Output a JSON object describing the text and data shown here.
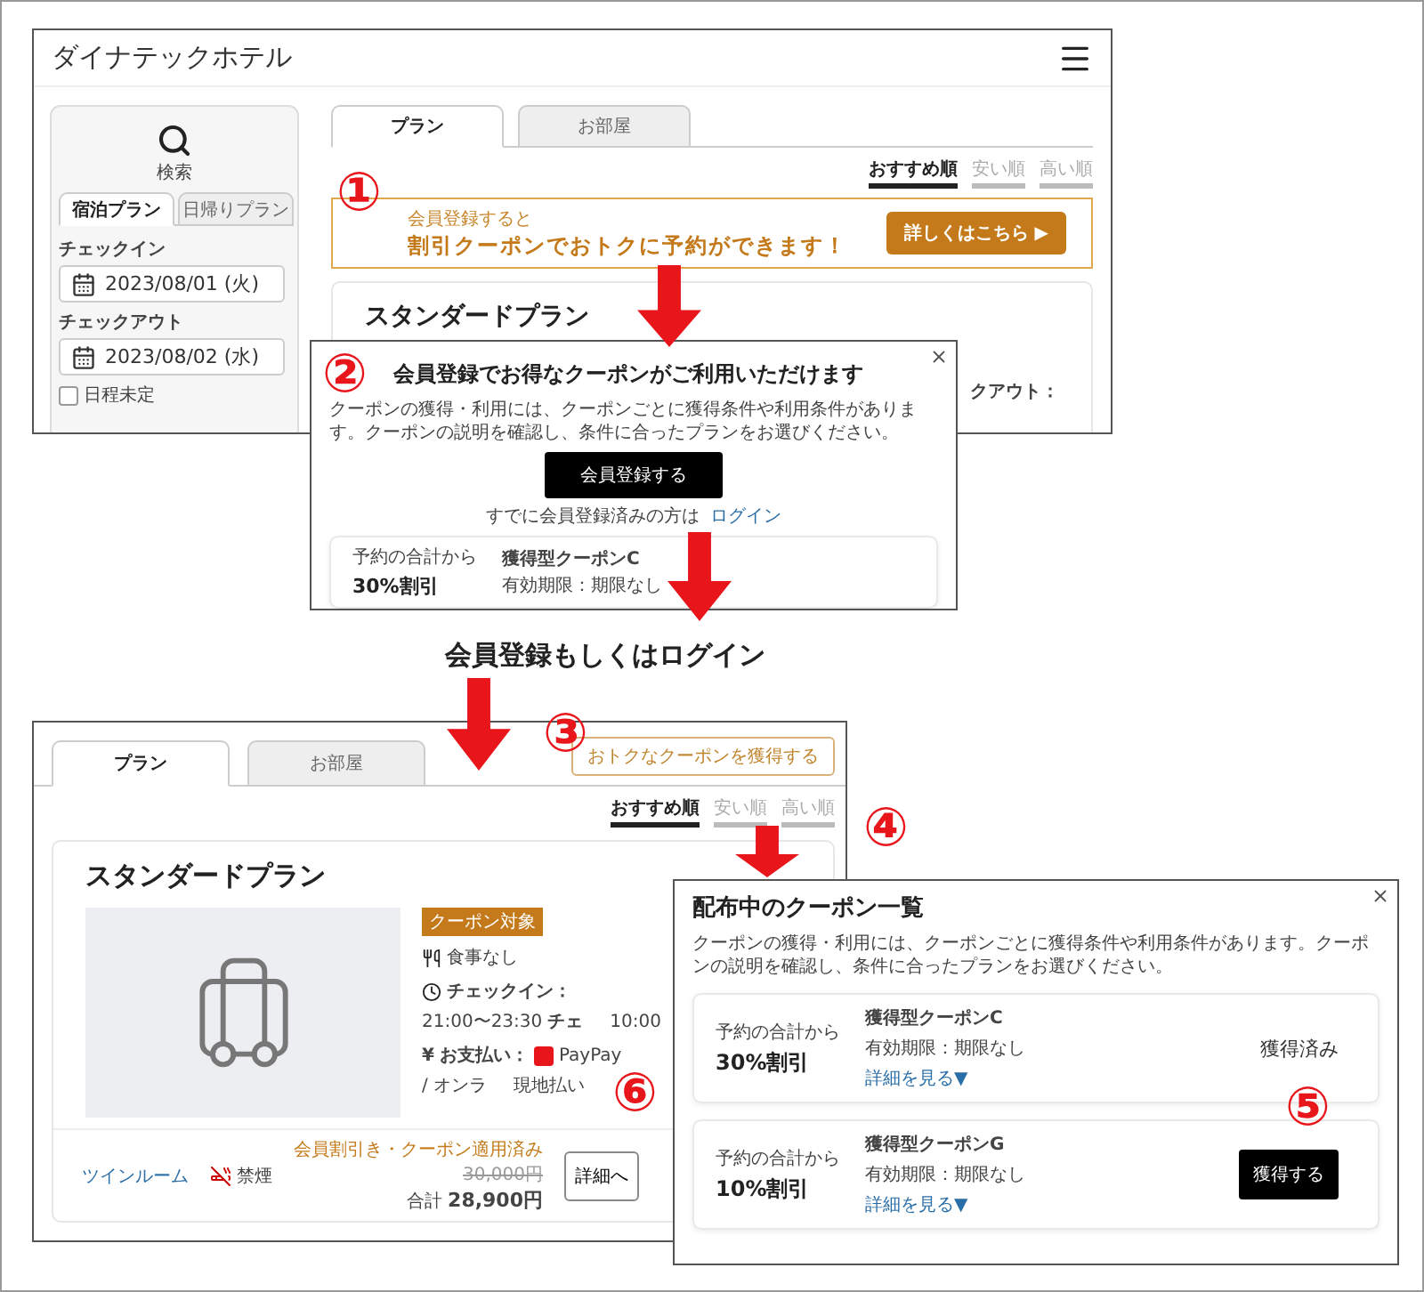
{
  "top_screen": {
    "site_title": "ダイナテックホテル",
    "sidebar": {
      "search_label": "検索",
      "tabs": [
        {
          "label": "宿泊プラン",
          "selected": true
        },
        {
          "label": "日帰りプラン",
          "selected": false
        }
      ],
      "checkin_label": "チェックイン",
      "checkin_value": "2023/08/01 (火)",
      "checkout_label": "チェックアウト",
      "checkout_value": "2023/08/02 (水)",
      "undecided": {
        "label": "日程未定",
        "checked": false
      }
    },
    "tabs": [
      {
        "label": "プラン",
        "selected": true
      },
      {
        "label": "お部屋",
        "selected": false
      }
    ],
    "sort": [
      {
        "label": "おすすめ順",
        "selected": true
      },
      {
        "label": "安い順",
        "selected": false
      },
      {
        "label": "高い順",
        "selected": false
      }
    ],
    "banner": {
      "lead": "会員登録すると",
      "headline": "割引クーポンでおトクに予約ができます！",
      "button": "詳しくはこちら ▶"
    },
    "plan_title": "スタンダードプラン",
    "cut_text": "クアウト："
  },
  "signup_modal": {
    "title": "会員登録でお得なクーポンがご利用いただけます",
    "description": "クーポンの獲得・利用には、クーポンごとに獲得条件や利用条件があります。クーポンの説明を確認し、条件に合ったプランをお選びください。",
    "button": "会員登録する",
    "login_prompt": "すでに会員登録済みの方は",
    "login_link": "ログイン",
    "coupon": {
      "lead": "予約の合計から",
      "discount": "30%割引",
      "name": "獲得型クーポンC",
      "validity": "有効期限：期限なし"
    }
  },
  "caption": "会員登録もしくはログイン",
  "bottom_screen": {
    "tabs": [
      {
        "label": "プラン",
        "selected": true
      },
      {
        "label": "お部屋",
        "selected": false
      }
    ],
    "coupon_button": "おトクなクーポンを獲得する",
    "sort": [
      {
        "label": "おすすめ順",
        "selected": true
      },
      {
        "label": "安い順",
        "selected": false
      },
      {
        "label": "高い順",
        "selected": false
      }
    ],
    "plan": {
      "title": "スタンダードプラン",
      "badge": "クーポン対象",
      "meal": "食事なし",
      "checkin_label": "チェックイン：",
      "checkin_value": "21:00〜23:30",
      "checkout_cut": "チェ",
      "checkout_time": "10:00",
      "yen_mark": "¥",
      "payment_label": "お支払い：",
      "paypay": "PayPay",
      "payment_cut": "/ オンラ",
      "pay_local": "現地払い",
      "room": "ツインルーム",
      "smoking": "禁煙",
      "discount_note": "会員割引き・クーポン適用済み",
      "original_price": "30,000円",
      "total_label": "合計",
      "total": "28,900円",
      "detail_button": "詳細へ"
    }
  },
  "coupon_modal": {
    "title": "配布中のクーポン一覧",
    "description": "クーポンの獲得・利用には、クーポンごとに獲得条件や利用条件があります。クーポンの説明を確認し、条件に合ったプランをお選びください。",
    "coupons": [
      {
        "lead": "予約の合計から",
        "discount": "30%割引",
        "name": "獲得型クーポンC",
        "validity": "有効期限：期限なし",
        "details": "詳細を見る▼",
        "acquired": true,
        "action": "獲得済み"
      },
      {
        "lead": "予約の合計から",
        "discount": "10%割引",
        "name": "獲得型クーポンG",
        "validity": "有効期限：期限なし",
        "details": "詳細を見る▼",
        "acquired": false,
        "action": "獲得する"
      }
    ]
  },
  "markers": [
    "①",
    "②",
    "③",
    "④",
    "⑤",
    "⑥"
  ]
}
